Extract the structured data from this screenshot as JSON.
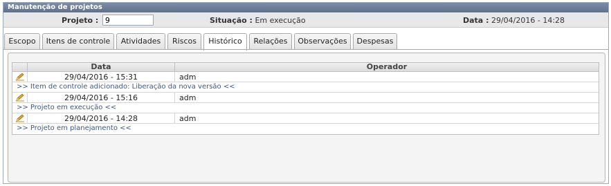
{
  "panel": {
    "title": "Manutenção de projetos"
  },
  "info": {
    "projeto_label": "Projeto :",
    "projeto_value": "9",
    "situacao_label": "Situação :",
    "situacao_value": "Em execução",
    "data_label": "Data :",
    "data_value": "29/04/2016 - 14:28"
  },
  "tabs": [
    {
      "label": "Escopo"
    },
    {
      "label": "Itens de controle"
    },
    {
      "label": "Atividades"
    },
    {
      "label": "Riscos"
    },
    {
      "label": "Histórico",
      "active": true
    },
    {
      "label": "Relações"
    },
    {
      "label": "Observações"
    },
    {
      "label": "Despesas"
    }
  ],
  "grid": {
    "columns": {
      "data": "Data",
      "operador": "Operador"
    },
    "entries": [
      {
        "icon": "pencil-icon",
        "data": "29/04/2016 - 15:31",
        "operador": "adm",
        "detail": ">> Item de controle adicionado: Liberação da nova versão <<"
      },
      {
        "icon": "pencil-icon",
        "data": "29/04/2016 - 15:16",
        "operador": "adm",
        "detail": ">> Projeto em execução <<"
      },
      {
        "icon": "pencil-icon",
        "data": "29/04/2016 - 14:28",
        "operador": "adm",
        "detail": ">> Projeto em planejamento <<"
      }
    ]
  }
}
